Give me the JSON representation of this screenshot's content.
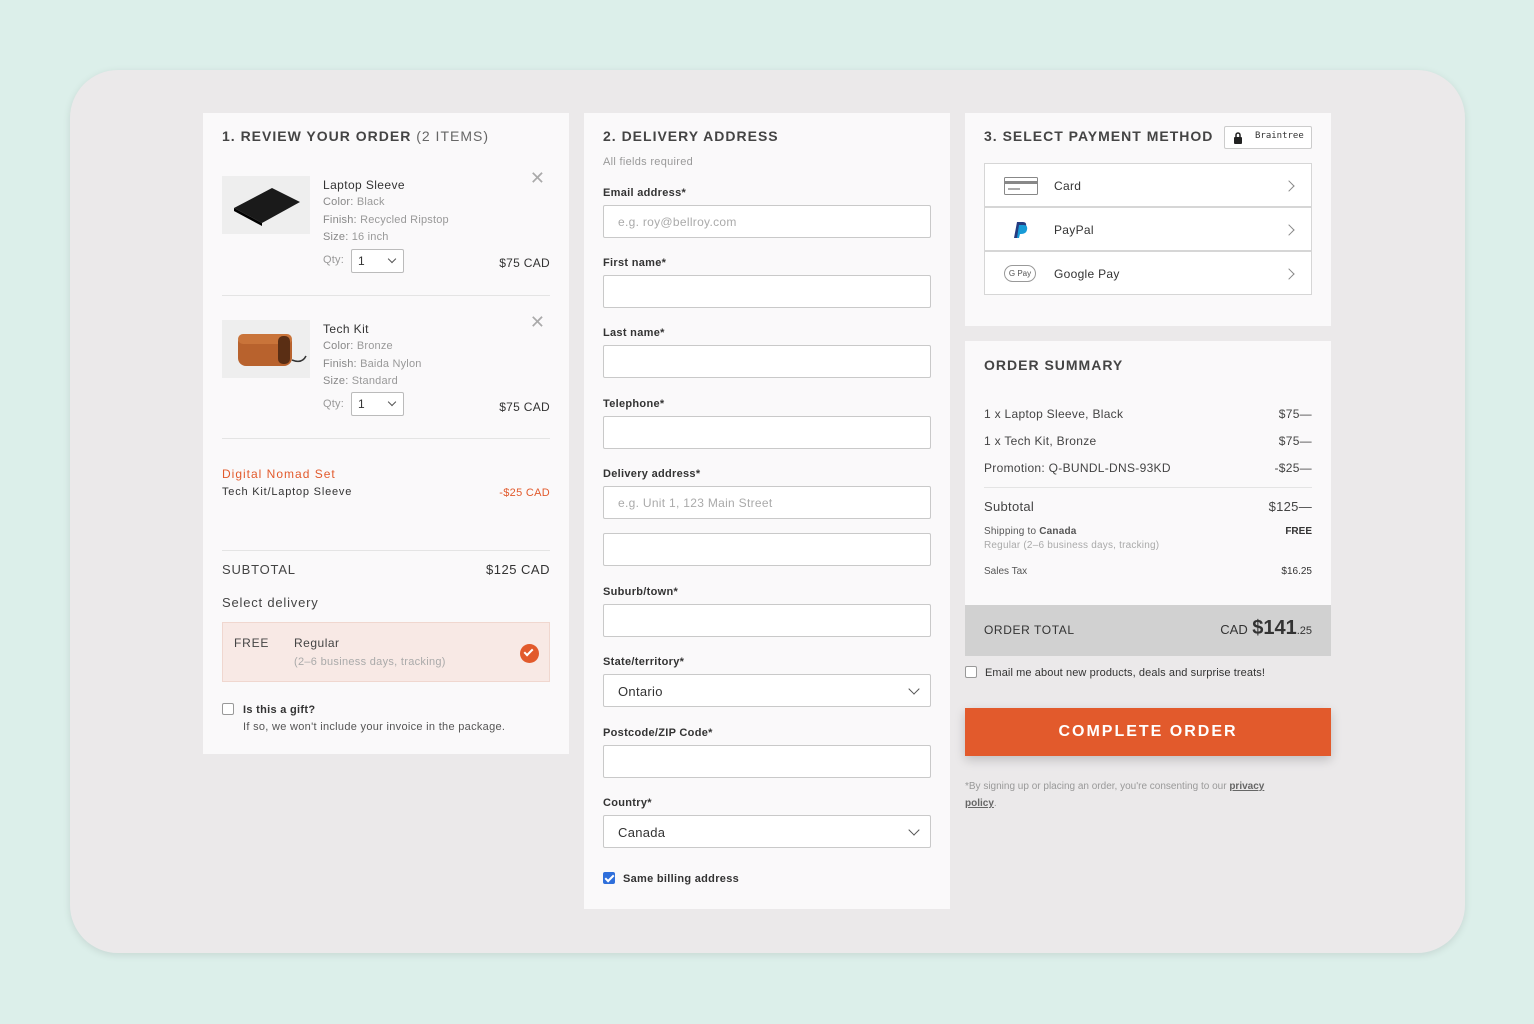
{
  "review": {
    "title": "1. REVIEW YOUR ORDER",
    "count": "(2 ITEMS)",
    "items": [
      {
        "name": "Laptop Sleeve",
        "color_label": "Color:",
        "color": "Black",
        "finish_label": "Finish:",
        "finish": "Recycled Ripstop",
        "size_label": "Size:",
        "size": "16 inch",
        "qty_label": "Qty:",
        "qty": "1",
        "price": "$75 CAD"
      },
      {
        "name": "Tech Kit",
        "color_label": "Color:",
        "color": "Bronze",
        "finish_label": "Finish:",
        "finish": "Baida Nylon",
        "size_label": "Size:",
        "size": "Standard",
        "qty_label": "Qty:",
        "qty": "1",
        "price": "$75 CAD"
      }
    ],
    "promo": {
      "name": "Digital Nomad Set",
      "desc": "Tech Kit/Laptop Sleeve",
      "amount": "-$25 CAD"
    },
    "subtotal_label": "SUBTOTAL",
    "subtotal": "$125 CAD",
    "select_delivery": "Select delivery",
    "delivery": {
      "price": "FREE",
      "name": "Regular",
      "detail": "(2–6 business days, tracking)"
    },
    "gift_label": "Is this a gift?",
    "gift_note": "If so, we won't include your invoice in the package."
  },
  "delivery_address": {
    "title": "2. DELIVERY ADDRESS",
    "required": "All fields required",
    "email_label": "Email address*",
    "email_placeholder": "e.g. roy@bellroy.com",
    "first_label": "First name*",
    "last_label": "Last name*",
    "phone_label": "Telephone*",
    "address_label": "Delivery address*",
    "address_placeholder": "e.g. Unit 1, 123 Main Street",
    "suburb_label": "Suburb/town*",
    "state_label": "State/territory*",
    "state_value": "Ontario",
    "postcode_label": "Postcode/ZIP Code*",
    "country_label": "Country*",
    "country_value": "Canada",
    "same_billing": "Same billing address"
  },
  "payment": {
    "title": "3. SELECT PAYMENT METHOD",
    "provider": "Braintree",
    "methods": [
      {
        "label": "Card",
        "icon": "credit-card-icon"
      },
      {
        "label": "PayPal",
        "icon": "paypal-icon"
      },
      {
        "label": "Google Pay",
        "icon": "google-pay-icon"
      }
    ],
    "gpay_text": "G Pay"
  },
  "summary": {
    "title": "ORDER SUMMARY",
    "lines": [
      {
        "label": "1 x Laptop Sleeve, Black",
        "value": "$75—"
      },
      {
        "label": "1 x Tech Kit, Bronze",
        "value": "$75—"
      },
      {
        "label": "Promotion: Q-BUNDL-DNS-93KD",
        "value": "-$25—"
      }
    ],
    "subtotal_label": "Subtotal",
    "subtotal": "$125—",
    "shipping_label_prefix": "Shipping to",
    "shipping_country": "Canada",
    "shipping_detail": "Regular (2–6 business days, tracking)",
    "shipping_value": "FREE",
    "tax_label": "Sales Tax",
    "tax_value": "$16.25",
    "total_label": "ORDER TOTAL",
    "total_currency": "CAD",
    "total_main": "$141",
    "total_cents": ".25"
  },
  "newsletter_label": "Email me about new products, deals and surprise treats!",
  "complete_button": "COMPLETE ORDER",
  "consent_text": "*By signing up or placing an order, you're consenting to our",
  "consent_link_1": "privacy",
  "consent_link_2": "policy",
  "colors": {
    "accent": "#e25a2c",
    "promo": "#e25a2c",
    "bg": "#dcefea"
  }
}
